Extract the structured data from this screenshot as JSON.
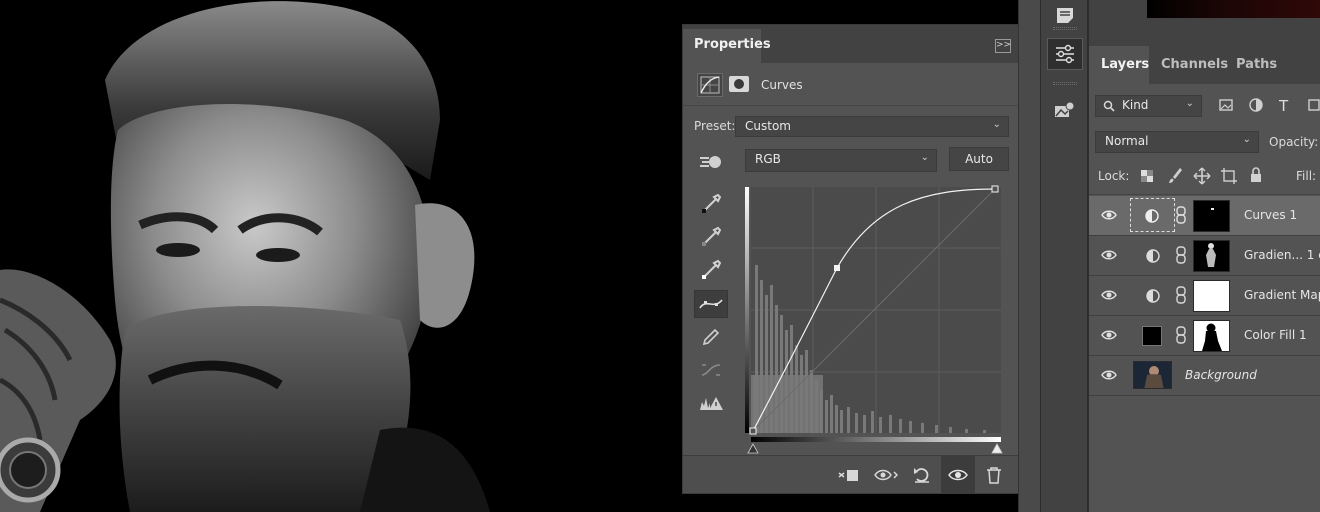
{
  "properties": {
    "tab_label": "Properties",
    "collapse_glyph": ">>",
    "adjustment_label": "Curves",
    "preset_label": "Preset:",
    "preset_value": "Custom",
    "channel_value": "RGB",
    "auto_label": "Auto"
  },
  "layers_panel": {
    "tabs": [
      "Layers",
      "Channels",
      "Paths"
    ],
    "filter_kind": "Kind",
    "blend_mode": "Normal",
    "opacity_label": "Opacity:",
    "lock_label": "Lock:",
    "fill_label": "Fill:",
    "layers": [
      {
        "name": "Curves 1",
        "type": "adjustment",
        "selected": true
      },
      {
        "name": "Gradien... 1 c",
        "type": "adjustment",
        "selected": false
      },
      {
        "name": "Gradient Map",
        "type": "adjustment",
        "selected": false
      },
      {
        "name": "Color Fill 1",
        "type": "fill",
        "selected": false
      },
      {
        "name": "Background",
        "type": "pixel",
        "selected": false,
        "italic": true
      }
    ]
  },
  "colors": {
    "panel_bg": "#535353",
    "panel_dark": "#424242",
    "selected_row": "#6a6a6a",
    "canvas_bg": "#000000"
  }
}
